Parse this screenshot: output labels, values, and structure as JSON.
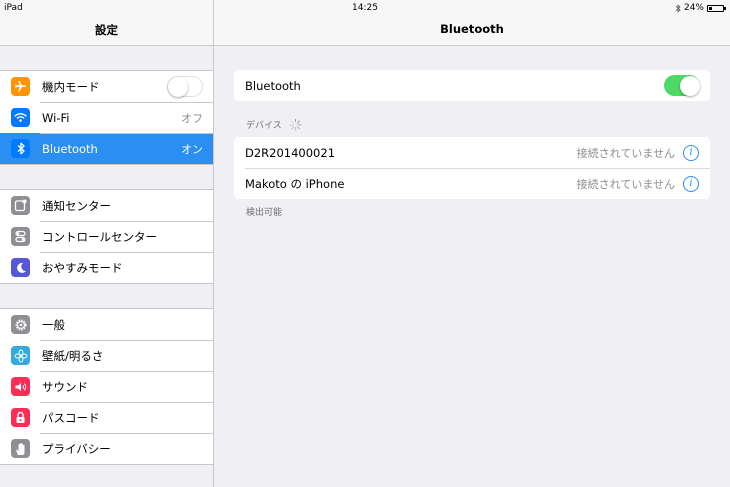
{
  "status_bar": {
    "device": "iPad",
    "time": "14:25",
    "battery": "24%",
    "battery_level": 0.24
  },
  "left": {
    "title": "設定",
    "groups": [
      [
        {
          "label": "機内モード",
          "icon": "airplane-icon",
          "color": "#ff9500",
          "control": "toggle-off"
        },
        {
          "label": "Wi-Fi",
          "icon": "wifi-icon",
          "color": "#007aff",
          "value": "オフ"
        },
        {
          "label": "Bluetooth",
          "icon": "bluetooth-icon",
          "color": "#007aff",
          "value": "オン",
          "selected": true
        }
      ],
      [
        {
          "label": "通知センター",
          "icon": "notification-center-icon",
          "color": "#8e8e93"
        },
        {
          "label": "コントロールセンター",
          "icon": "control-center-icon",
          "color": "#8e8e93"
        },
        {
          "label": "おやすみモード",
          "icon": "moon-icon",
          "color": "#5856d6"
        }
      ],
      [
        {
          "label": "一般",
          "icon": "gear-icon",
          "color": "#8e8e93"
        },
        {
          "label": "壁紙/明るさ",
          "icon": "wallpaper-icon",
          "color": "#34aadc"
        },
        {
          "label": "サウンド",
          "icon": "speaker-icon",
          "color": "#ff2d55"
        },
        {
          "label": "パスコード",
          "icon": "lock-icon",
          "color": "#ff2d55"
        },
        {
          "label": "プライバシー",
          "icon": "hand-icon",
          "color": "#8e8e93"
        }
      ]
    ]
  },
  "right": {
    "title": "Bluetooth",
    "bluetooth_toggle": {
      "label": "Bluetooth",
      "on": true
    },
    "devices_header": "デバイス",
    "devices": [
      {
        "name": "D2R201400021",
        "status": "接続されていません"
      },
      {
        "name": "Makoto の iPhone",
        "status": "接続されていません"
      }
    ],
    "footer": "検出可能"
  },
  "colors": {
    "accent": "#007aff",
    "toggle_on": "#4cd964",
    "selected_row": "#2a8ff0"
  }
}
